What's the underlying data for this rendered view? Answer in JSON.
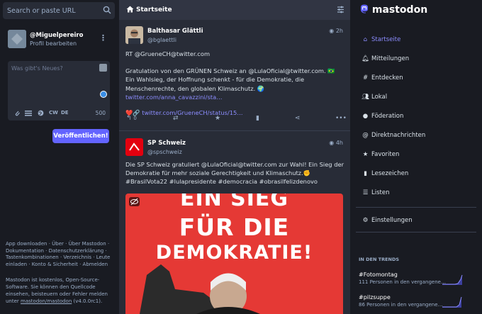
{
  "search": {
    "placeholder": "Search or paste URL"
  },
  "profile": {
    "username": "@Miguelpereiro",
    "edit_label": "Profil bearbeiten"
  },
  "compose": {
    "placeholder": "Was gibt's Neues?",
    "tools": [
      "CW",
      "DE"
    ],
    "char_count": "500",
    "publish_label": "Veröffentlichen!"
  },
  "footer": {
    "links": "App downloaden · Über · Über Mastodon · Dokumentation · Datenschutzerklärung · Tastenkombinationen · Verzeichnis · Leute einladen · Konto & Sicherheit · Abmelden",
    "about_prefix": "Mastodon ist kostenlos, Open-Source-Software. Sie können den Quellcode einsehen, beisteuern oder Fehler melden unter ",
    "repo_link": "mastodon/mastodon",
    "version": " (v4.0.0rc1)."
  },
  "column": {
    "title": "Startseite"
  },
  "posts": [
    {
      "name": "Balthasar Glättli",
      "handle": "@bglaettli",
      "time": "2h",
      "line1": "RT @GrueneCH@twitter.com",
      "line2": "Gratulation von den GRÜNEN Schweiz an @LulaOficial@twitter.com. 🇧🇷",
      "line3_a": "Ein Wahlsieg, der Hoffnung schenkt - für die Demokratie, die Menschenrechte, den globalen Klimaschutz. 🌍 ",
      "line3_link": "twitter.com/anna_cavazzini/sta…",
      "line4_link": "twitter.com/GrueneCH/status/15…",
      "reply_count": "0"
    },
    {
      "name": "SP Schweiz",
      "handle": "@spschweiz",
      "time": "4h",
      "text": "Die SP Schweiz gratuliert @LulaOficial@twitter.com zur Wahl! Ein Sieg der Demokratie für mehr soziale Gerechtigkeit und Klimaschutz.✊ #BrasilVota22 #lulapresidente #democracia  #obrasilfelizdenovo",
      "media_lines": [
        "EIN SIEG",
        "FÜR DIE",
        "DEMOKRATIE!"
      ]
    }
  ],
  "brand": "mastodon",
  "nav": [
    {
      "label": "Startseite",
      "icon": "home-icon"
    },
    {
      "label": "Mitteilungen",
      "icon": "bell-icon"
    },
    {
      "label": "Entdecken",
      "icon": "hashtag-icon"
    },
    {
      "label": "Lokal",
      "icon": "users-icon"
    },
    {
      "label": "Föderation",
      "icon": "globe-icon"
    },
    {
      "label": "Direktnachrichten",
      "icon": "at-icon"
    },
    {
      "label": "Favoriten",
      "icon": "star-icon"
    },
    {
      "label": "Lesezeichen",
      "icon": "bookmark-icon"
    },
    {
      "label": "Listen",
      "icon": "list-icon"
    },
    {
      "label": "Einstellungen",
      "icon": "gear-icon"
    }
  ],
  "trends": {
    "heading": "IN DEN TRENDS",
    "items": [
      {
        "tag": "#Fotomontag",
        "sub": "111 Personen in den vergangene…"
      },
      {
        "tag": "#pilzsuppe",
        "sub": "86 Personen in den vergangene…"
      }
    ]
  },
  "colors": {
    "accent": "#8c8dff",
    "button": "#6364ff",
    "bg": "#191b22",
    "panel": "#282c37"
  }
}
